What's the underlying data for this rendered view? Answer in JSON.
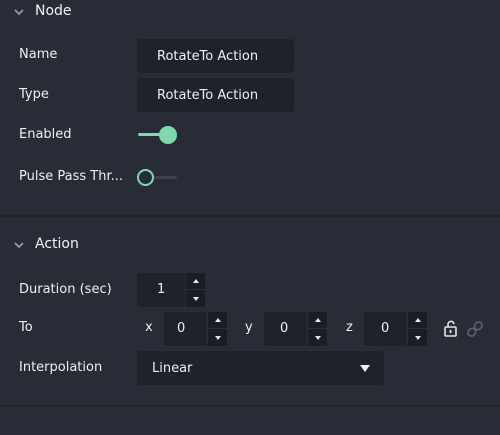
{
  "node_section": {
    "title": "Node",
    "fields": {
      "name_label": "Name",
      "name_value": "RotateTo Action",
      "type_label": "Type",
      "type_value": "RotateTo Action",
      "enabled_label": "Enabled",
      "enabled_on": true,
      "pulse_label": "Pulse Pass Thr...",
      "pulse_on": false
    }
  },
  "action_section": {
    "title": "Action",
    "duration_label": "Duration (sec)",
    "duration_value": "1",
    "to_label": "To",
    "to": {
      "x_label": "x",
      "x_value": "0",
      "y_label": "y",
      "y_value": "0",
      "z_label": "z",
      "z_value": "0"
    },
    "interpolation_label": "Interpolation",
    "interpolation_value": "Linear"
  },
  "colors": {
    "background": "#282c37",
    "field_bg": "#1e222b",
    "accent": "#7ed8b0"
  },
  "icons": {
    "section_toggle": "chevron-down-icon",
    "lock": "unlock-icon",
    "link": "link-icon",
    "dropdown": "caret-down-icon"
  }
}
